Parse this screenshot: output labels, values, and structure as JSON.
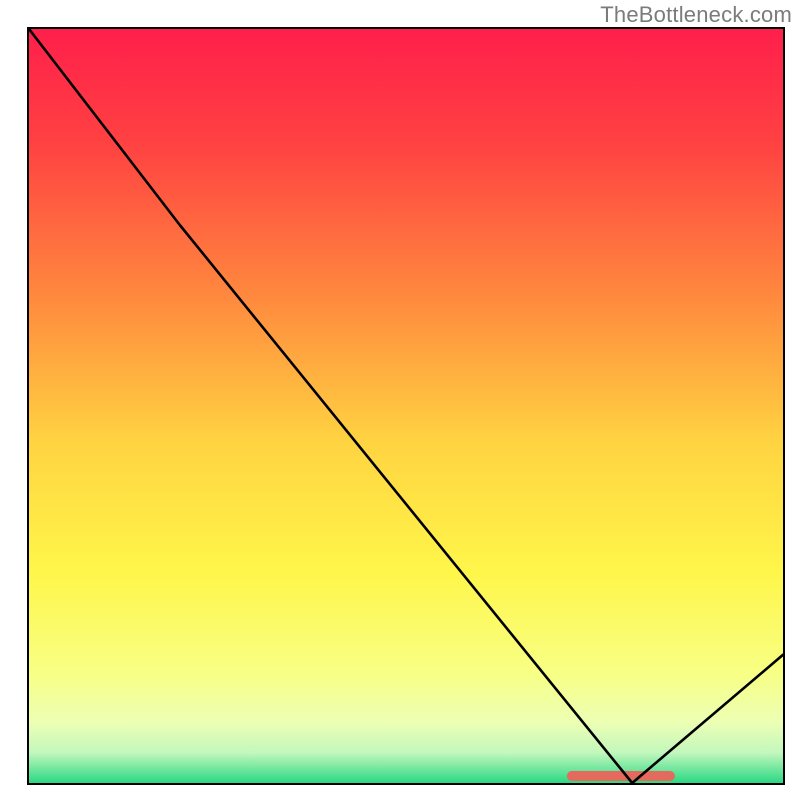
{
  "attribution": "TheBottleneck.com",
  "chart_data": {
    "type": "line",
    "title": "",
    "xlabel": "",
    "ylabel": "",
    "xlim": [
      0,
      100
    ],
    "ylim": [
      0,
      100
    ],
    "x": [
      0,
      20,
      80,
      100
    ],
    "values": [
      100,
      74,
      0,
      17
    ],
    "highlight_band": {
      "x0": 72,
      "x1": 85,
      "y": 0
    },
    "background_gradient": {
      "stops": [
        {
          "pos": 0.0,
          "color": "#ff1f4b"
        },
        {
          "pos": 0.15,
          "color": "#ff4142"
        },
        {
          "pos": 0.35,
          "color": "#ff873e"
        },
        {
          "pos": 0.55,
          "color": "#ffd441"
        },
        {
          "pos": 0.72,
          "color": "#fff64a"
        },
        {
          "pos": 0.85,
          "color": "#f8ff82"
        },
        {
          "pos": 0.92,
          "color": "#ecffb4"
        },
        {
          "pos": 0.96,
          "color": "#c2f7bd"
        },
        {
          "pos": 1.0,
          "color": "#2bd983"
        }
      ]
    }
  }
}
